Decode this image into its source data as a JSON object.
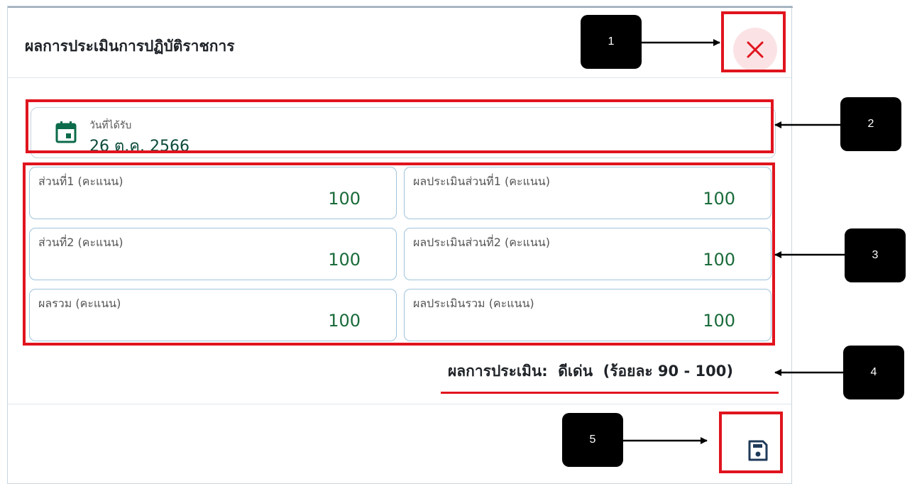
{
  "dialog": {
    "title": "ผลการประเมินการปฏิบัติราชการ",
    "date_field": {
      "label": "วันที่ได้รับ",
      "value": "26 ต.ค. 2566"
    },
    "scores": [
      {
        "label": "ส่วนที่1 (คะแนน)",
        "value": "100"
      },
      {
        "label": "ผลประเมินส่วนที่1 (คะแนน)",
        "value": "100"
      },
      {
        "label": "ส่วนที่2 (คะแนน)",
        "value": "100"
      },
      {
        "label": "ผลประเมินส่วนที่2 (คะแนน)",
        "value": "100"
      },
      {
        "label": "ผลรวม (คะแนน)",
        "value": "100"
      },
      {
        "label": "ผลประเมินรวม (คะแนน)",
        "value": "100"
      }
    ],
    "result_text": "ผลการประเมิน:  ดีเด่น  (ร้อยละ 90 - 100)"
  },
  "icons": {
    "close": "close-icon",
    "calendar": "calendar-icon",
    "save": "save-icon"
  },
  "callouts": [
    "1",
    "2",
    "3",
    "4",
    "5"
  ],
  "colors": {
    "accent_green": "#0b6b4a",
    "value_green": "#1a6b3a",
    "highlight_red": "#e0141e",
    "close_bg": "#fbe3e5",
    "save_icon": "#1f3a5a"
  }
}
